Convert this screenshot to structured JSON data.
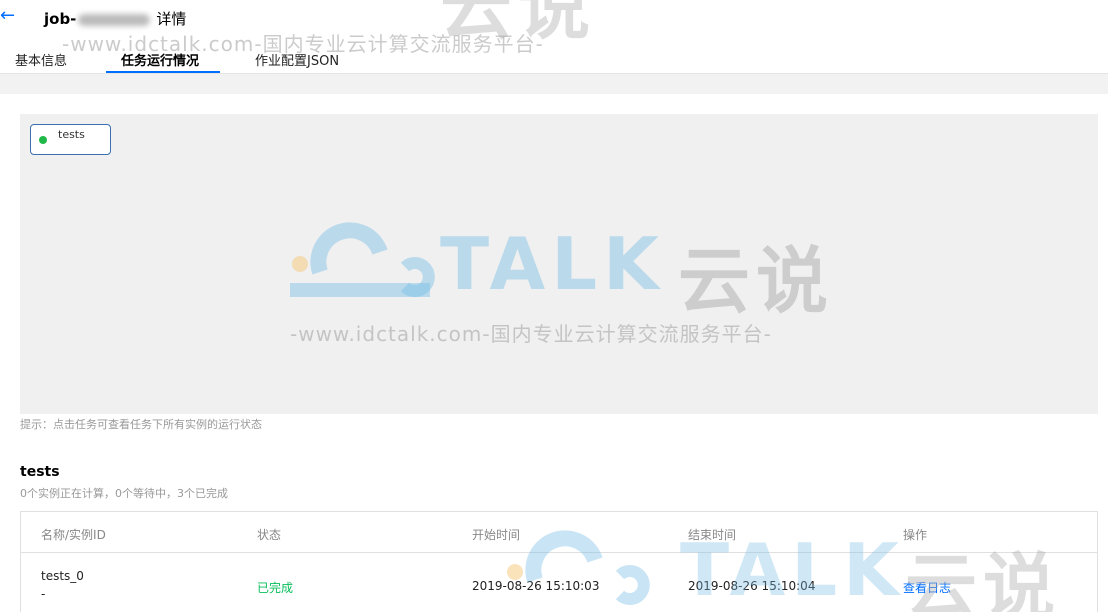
{
  "header": {
    "back_icon": "arrow-left-icon",
    "title_prefix": "job-",
    "title_suffix": "详情"
  },
  "tabs": [
    {
      "label": "基本信息",
      "active": false
    },
    {
      "label": "任务运行情况",
      "active": true
    },
    {
      "label": "作业配置JSON",
      "active": false
    }
  ],
  "graph": {
    "nodes": [
      {
        "label": "tests",
        "status_color": "#21b84a"
      }
    ]
  },
  "hint": "提示：点击任务可查看任务下所有实例的运行状态",
  "task": {
    "name": "tests",
    "summary": "0个实例正在计算，0个等待中，3个已完成"
  },
  "table": {
    "columns": [
      "名称/实例ID",
      "状态",
      "开始时间",
      "结束时间",
      "操作"
    ],
    "rows": [
      {
        "name": "tests_0",
        "instance_id": "-",
        "status": "已完成",
        "start": "2019-08-26 15:10:03",
        "end": "2019-08-26 15:10:04",
        "action": "查看日志"
      }
    ]
  },
  "watermark": {
    "url_text": "-www.idctalk.com-国内专业云计算交流服务平台-",
    "brand_talk": "TALK",
    "brand_cn": "云说"
  },
  "colors": {
    "accent": "#006eff",
    "success": "#0abf5b",
    "node_border": "#3a6fb0"
  }
}
